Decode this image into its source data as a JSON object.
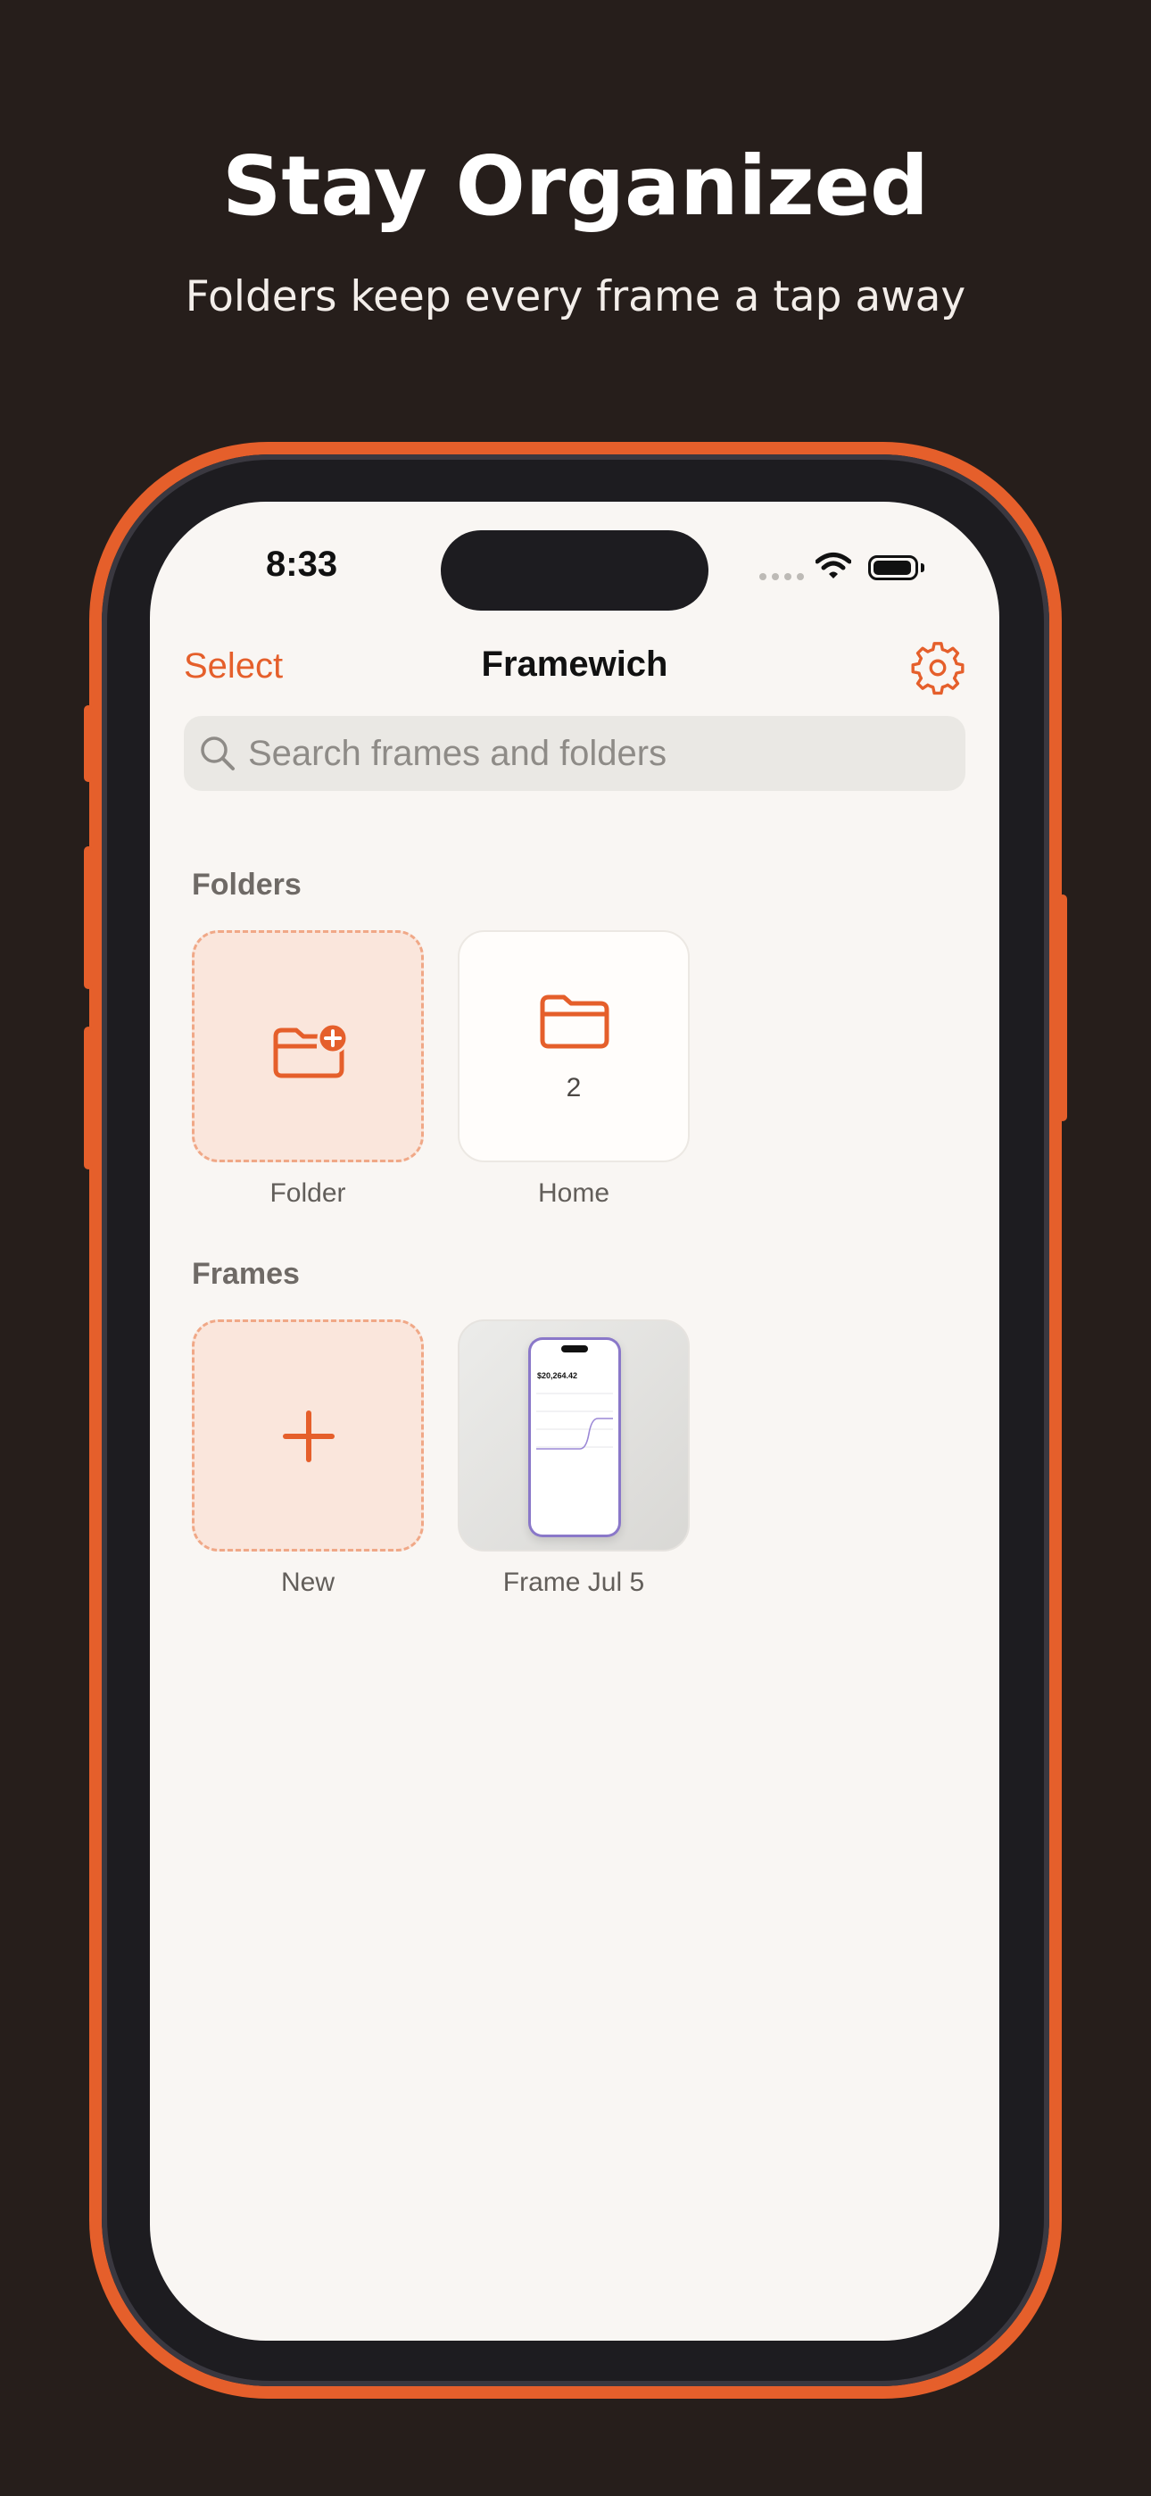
{
  "promo": {
    "headline": "Stay Organized",
    "subheadline": "Folders keep every frame a tap away"
  },
  "status_bar": {
    "time": "8:33"
  },
  "nav": {
    "select_label": "Select",
    "title": "Framewich",
    "settings_icon": "gear-icon"
  },
  "search": {
    "placeholder": "Search frames and folders",
    "value": ""
  },
  "folders": {
    "section_label": "Folders",
    "items": [
      {
        "label": "Folder",
        "icon": "folder-plus-icon"
      },
      {
        "label": "Home",
        "icon": "folder-icon",
        "count": "2"
      }
    ]
  },
  "frames": {
    "section_label": "Frames",
    "items": [
      {
        "label": "New",
        "icon": "plus-icon"
      },
      {
        "label": "Frame Jul 5",
        "preview_amount": "$20,264.42"
      }
    ]
  },
  "colors": {
    "accent": "#e55f2b",
    "background": "#261e1b",
    "screen": "#f9f6f3",
    "new_tile_fill": "#fae6dc",
    "preview_frame": "#8a78c9"
  }
}
